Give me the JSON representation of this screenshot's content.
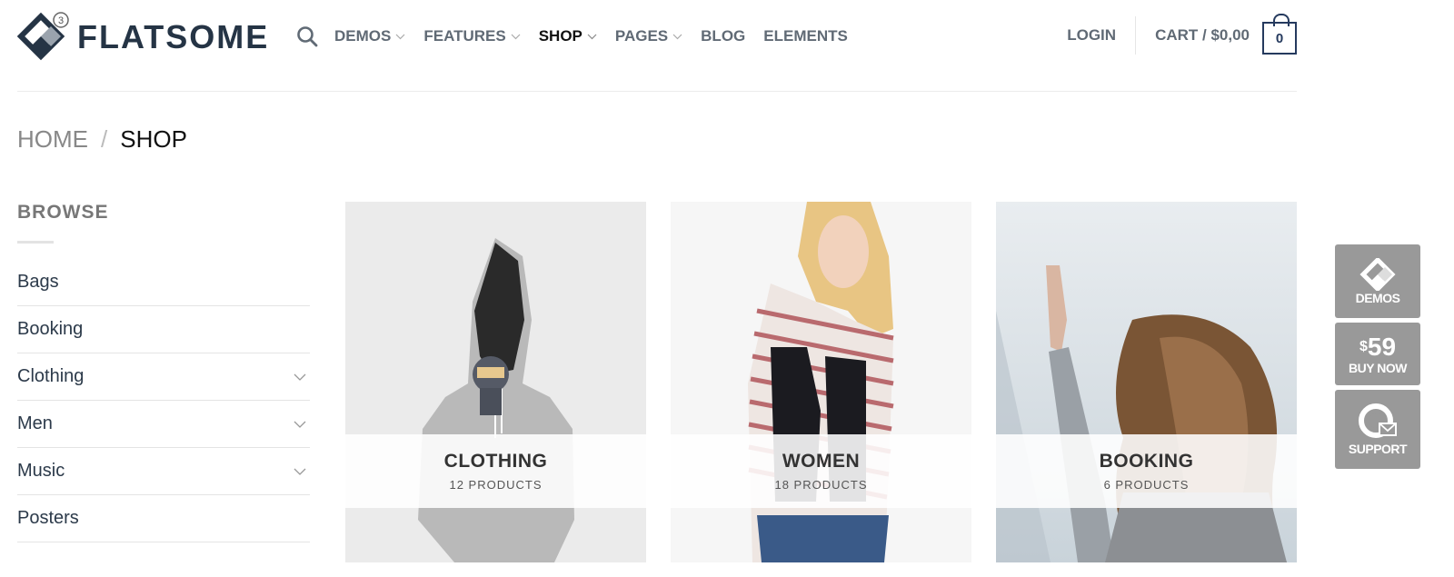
{
  "header": {
    "logo_text": "FLATSOME",
    "logo_badge": "3",
    "nav": [
      {
        "label": "DEMOS",
        "dropdown": true,
        "active": false
      },
      {
        "label": "FEATURES",
        "dropdown": true,
        "active": false
      },
      {
        "label": "SHOP",
        "dropdown": true,
        "active": true
      },
      {
        "label": "PAGES",
        "dropdown": true,
        "active": false
      },
      {
        "label": "BLOG",
        "dropdown": false,
        "active": false
      },
      {
        "label": "ELEMENTS",
        "dropdown": false,
        "active": false
      }
    ],
    "login_label": "LOGIN",
    "cart_label": "CART / $0,00",
    "cart_count": "0"
  },
  "breadcrumb": {
    "home": "HOME",
    "separator": "/",
    "current": "SHOP"
  },
  "sidebar": {
    "title": "BROWSE",
    "items": [
      {
        "label": "Bags",
        "expandable": false
      },
      {
        "label": "Booking",
        "expandable": false
      },
      {
        "label": "Clothing",
        "expandable": true
      },
      {
        "label": "Men",
        "expandable": true
      },
      {
        "label": "Music",
        "expandable": true
      },
      {
        "label": "Posters",
        "expandable": false
      }
    ]
  },
  "categories": [
    {
      "title": "CLOTHING",
      "count": "12 PRODUCTS"
    },
    {
      "title": "WOMEN",
      "count": "18 PRODUCTS"
    },
    {
      "title": "BOOKING",
      "count": "6 PRODUCTS"
    }
  ],
  "side_buttons": {
    "demos_label": "DEMOS",
    "price_symbol": "$",
    "price": "59",
    "buy_label": "BUY NOW",
    "support_label": "SUPPORT"
  },
  "colors": {
    "brand": "#253445",
    "nav_text": "#606a75",
    "cart_accent": "#253a5e",
    "side_button_bg": "#999999"
  }
}
